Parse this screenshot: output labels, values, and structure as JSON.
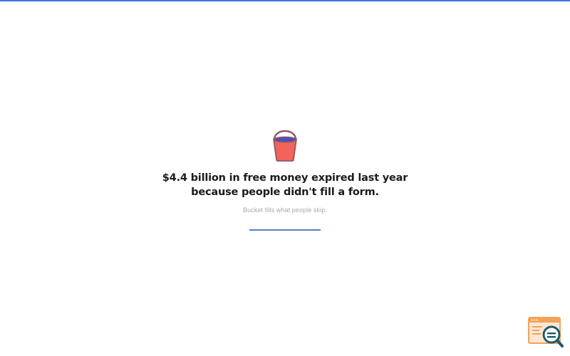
{
  "colors": {
    "top_accent": "#3a78d6",
    "bucket_body": "#f2635b",
    "bucket_handle": "#8c5a63",
    "bucket_water": "#4a4ec4",
    "headline": "#1b1b1b",
    "subtext": "#a9a9a9",
    "progress_fill": "#4f80c8",
    "widget_orange": "#f3a25a",
    "widget_teal": "#1f5b6b"
  },
  "hero": {
    "icon": "bucket-icon",
    "headline_line1": "$4.4 billion in free money expired last year",
    "headline_line2": "because people didn't fill a form.",
    "subtext": "Bucket fills what people skip.",
    "progress": 1.0
  },
  "corner_widget": {
    "icon": "browser-search-icon"
  }
}
